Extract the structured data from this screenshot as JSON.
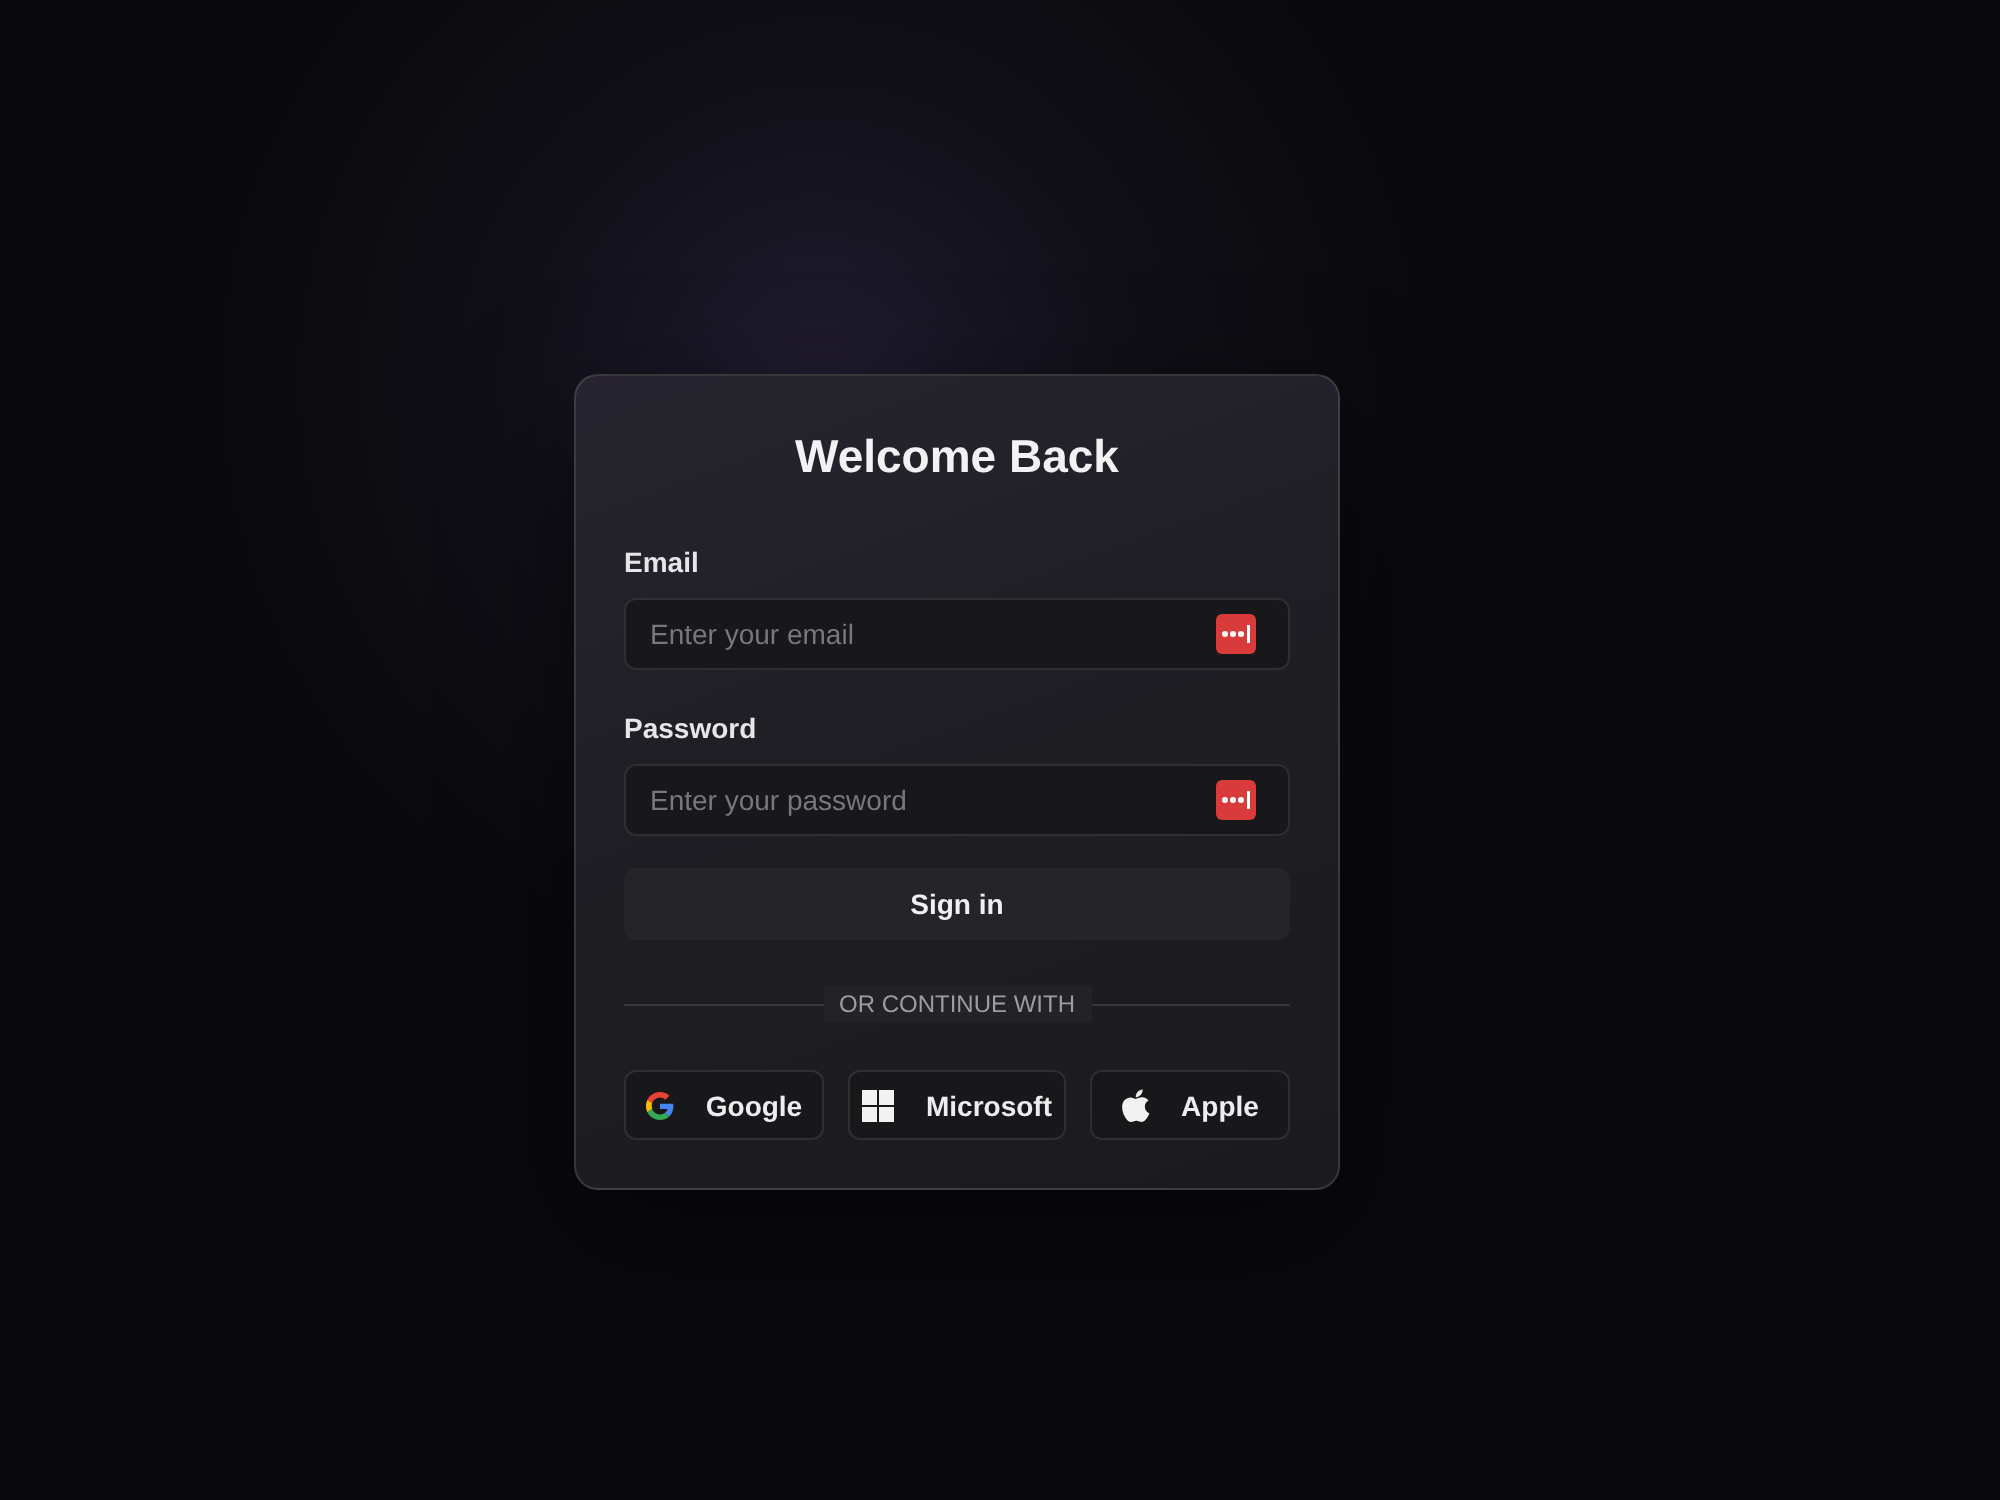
{
  "card": {
    "title": "Welcome Back"
  },
  "fields": [
    {
      "label": "Email",
      "placeholder": "Enter your email"
    },
    {
      "label": "Password",
      "placeholder": "Enter your password"
    }
  ],
  "submit": {
    "label": "Sign in"
  },
  "divider": {
    "label": "OR CONTINUE WITH"
  },
  "providers": [
    {
      "label": "Google",
      "kind": "google"
    },
    {
      "label": "Microsoft",
      "kind": "microsoft"
    },
    {
      "label": "Apple",
      "kind": "apple"
    }
  ]
}
